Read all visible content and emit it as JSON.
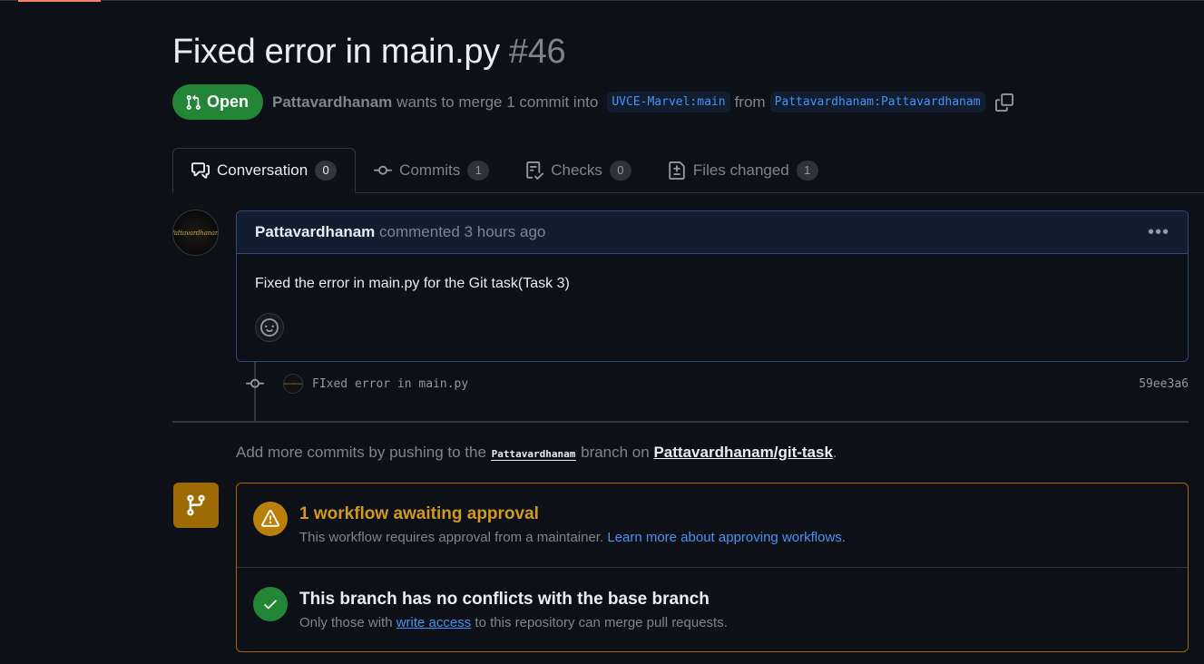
{
  "pr": {
    "title": "Fixed error in main.py",
    "number": "#46",
    "state": "Open",
    "author": "Pattavardhanam",
    "merge_text": "wants to merge 1 commit into",
    "base_branch": "UVCE-Marvel:main",
    "from_text": "from",
    "head_branch": "Pattavardhanam:Pattavardhanam"
  },
  "tabs": [
    {
      "label": "Conversation",
      "count": "0",
      "icon": "comment-discussion-icon"
    },
    {
      "label": "Commits",
      "count": "1",
      "icon": "git-commit-icon"
    },
    {
      "label": "Checks",
      "count": "0",
      "icon": "checklist-icon"
    },
    {
      "label": "Files changed",
      "count": "1",
      "icon": "file-diff-icon"
    }
  ],
  "comment": {
    "author": "Pattavardhanam",
    "action": "commented",
    "time": "3 hours ago",
    "body": "Fixed the error in main.py for the Git task(Task 3)",
    "avatar_text": "Pattavardhanam"
  },
  "commit": {
    "message": "FIxed error in main.py",
    "sha": "59ee3a6"
  },
  "push_note": {
    "prefix": "Add more commits by pushing to the",
    "branch": "Pattavardhanam",
    "middle": "branch on",
    "repo": "Pattavardhanam/git-task",
    "suffix": "."
  },
  "merge": {
    "workflow_title": "1 workflow awaiting approval",
    "workflow_desc": "This workflow requires approval from a maintainer.",
    "workflow_link": "Learn more about approving workflows.",
    "conflict_title": "This branch has no conflicts with the base branch",
    "conflict_desc_prefix": "Only those with",
    "conflict_link": "write access",
    "conflict_desc_suffix": "to this repository can merge pull requests."
  },
  "colors": {
    "background": "#0d1117",
    "open_green": "#238636",
    "link_blue": "#4493f8",
    "warning": "#d29922",
    "merge_border": "#9e6a03"
  }
}
